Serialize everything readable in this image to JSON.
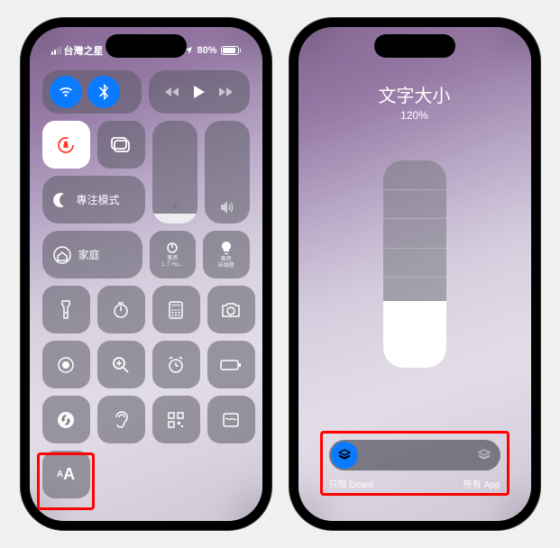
{
  "left": {
    "status": {
      "carrier": "台灣之星",
      "battery_pct": "80%"
    },
    "focus_label": "專注模式",
    "home_label": "家庭",
    "room1_top": "客房",
    "room1_bottom": "L.T Ho...",
    "room2_top": "客房",
    "room2_bottom": "床頭燈",
    "brightness_fill": "10%",
    "volume_fill": "0%",
    "text_size_small": "A",
    "text_size_large": "A"
  },
  "right": {
    "title": "文字大小",
    "percent": "120%",
    "slider_fill": "32%",
    "seg_left": "只限 Dcard",
    "seg_right": "所有 App"
  }
}
